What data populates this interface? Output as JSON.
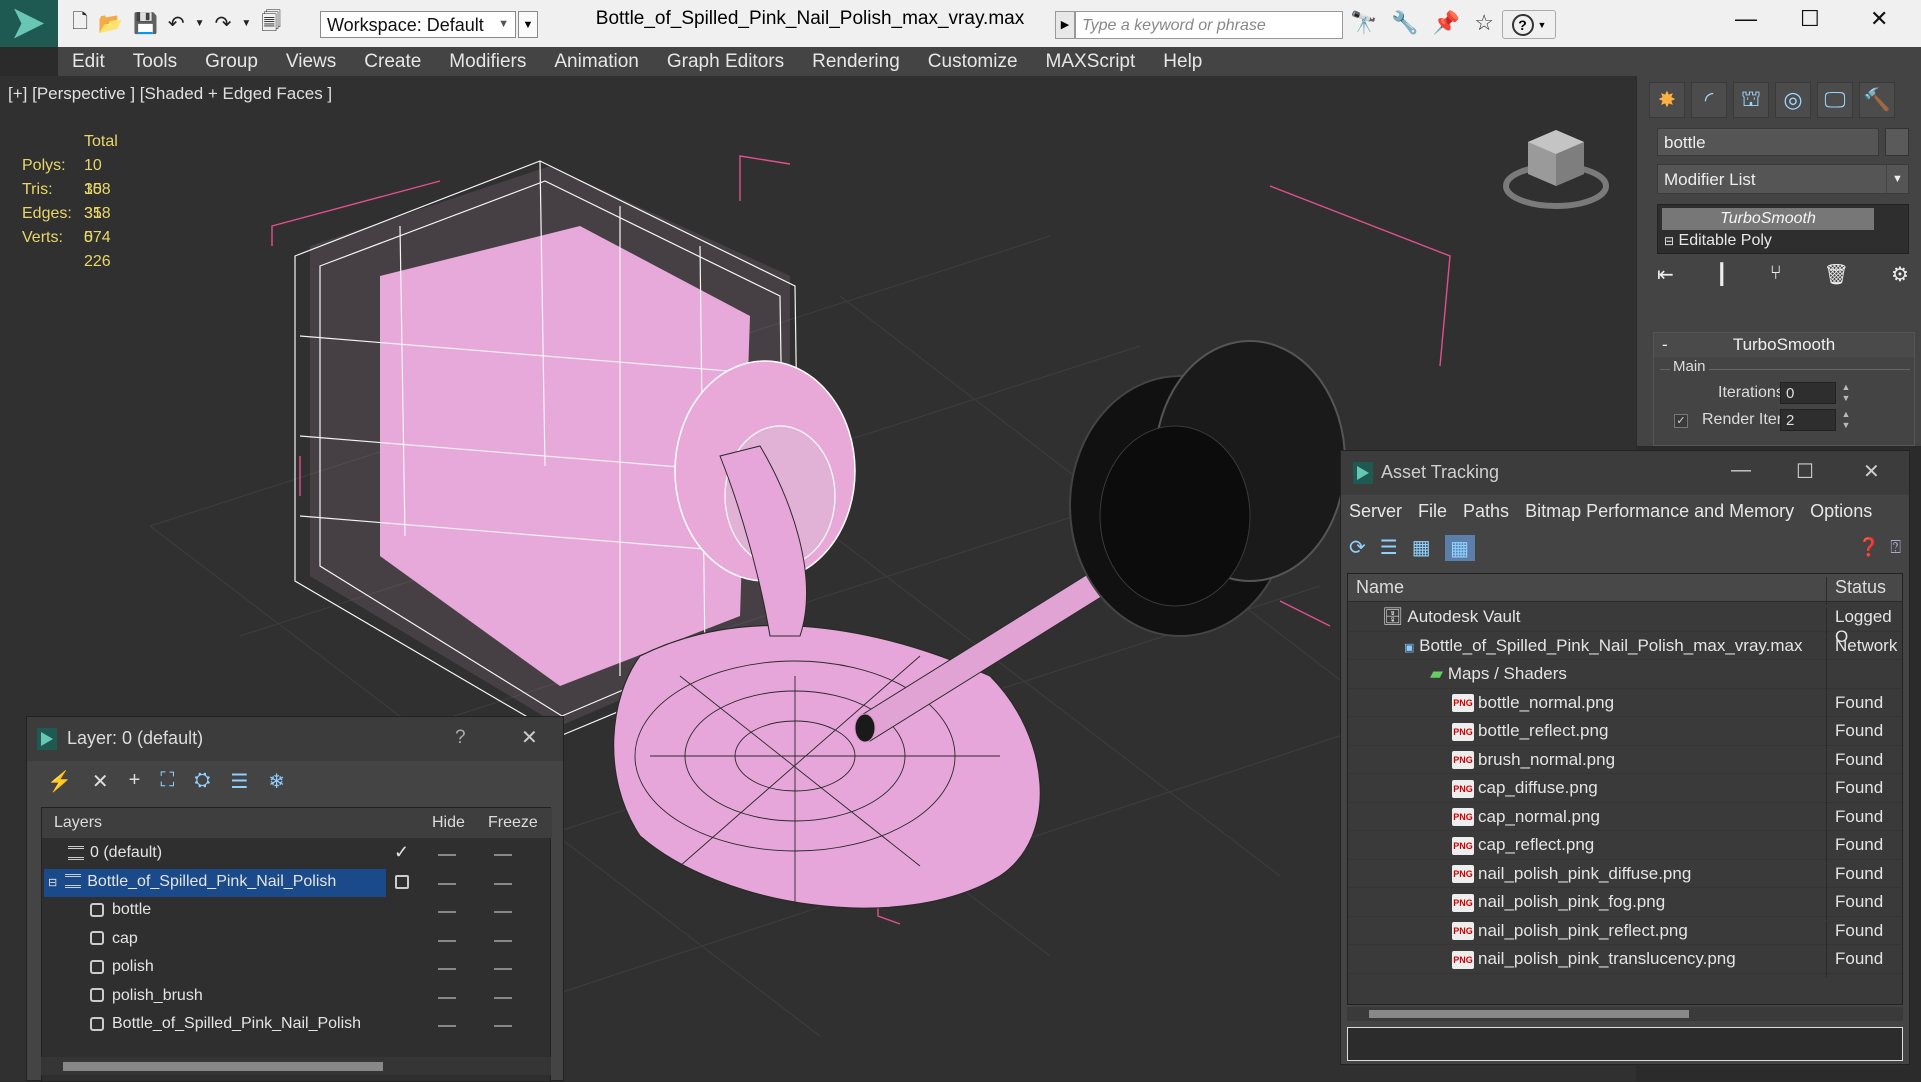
{
  "window": {
    "title": "Bottle_of_Spilled_Pink_Nail_Polish_max_vray.max",
    "workspace": "Workspace: Default",
    "search_placeholder": "Type a keyword or phrase"
  },
  "menu": [
    "Edit",
    "Tools",
    "Group",
    "Views",
    "Create",
    "Modifiers",
    "Animation",
    "Graph Editors",
    "Rendering",
    "Customize",
    "MAXScript",
    "Help"
  ],
  "viewport": {
    "label": "[+] [Perspective ] [Shaded + Edged Faces ]",
    "stats": {
      "header": "Total",
      "rows": [
        {
          "label": "Polys:",
          "value": "10 358"
        },
        {
          "label": "Tris:",
          "value": "10 358"
        },
        {
          "label": "Edges:",
          "value": "31 074"
        },
        {
          "label": "Verts:",
          "value": "5 226"
        }
      ]
    }
  },
  "command_panel": {
    "object_name": "bottle",
    "modifier_list": "Modifier List",
    "stack": [
      "TurboSmooth",
      "Editable Poly"
    ],
    "rollout_title": "TurboSmooth",
    "group_title": "Main",
    "iterations_label": "Iterations:",
    "iterations_value": "0",
    "render_iters_label": "Render Iters:",
    "render_iters_value": "2",
    "render_iters_checked": true
  },
  "asset_tracking": {
    "title": "Asset Tracking",
    "menu": [
      "Server",
      "File",
      "Paths",
      "Bitmap Performance and Memory",
      "Options"
    ],
    "columns": {
      "name": "Name",
      "status": "Status"
    },
    "rows": [
      {
        "name": "Autodesk Vault",
        "status": "Logged O",
        "type": "vault"
      },
      {
        "name": "Bottle_of_Spilled_Pink_Nail_Polish_max_vray.max",
        "status": "Network",
        "type": "max"
      },
      {
        "name": "Maps / Shaders",
        "status": "",
        "type": "folder"
      },
      {
        "name": "bottle_normal.png",
        "status": "Found",
        "type": "png"
      },
      {
        "name": "bottle_reflect.png",
        "status": "Found",
        "type": "png"
      },
      {
        "name": "brush_normal.png",
        "status": "Found",
        "type": "png"
      },
      {
        "name": "cap_diffuse.png",
        "status": "Found",
        "type": "png"
      },
      {
        "name": "cap_normal.png",
        "status": "Found",
        "type": "png"
      },
      {
        "name": "cap_reflect.png",
        "status": "Found",
        "type": "png"
      },
      {
        "name": "nail_polish_pink_diffuse.png",
        "status": "Found",
        "type": "png"
      },
      {
        "name": "nail_polish_pink_fog.png",
        "status": "Found",
        "type": "png"
      },
      {
        "name": "nail_polish_pink_reflect.png",
        "status": "Found",
        "type": "png"
      },
      {
        "name": "nail_polish_pink_translucency.png",
        "status": "Found",
        "type": "png"
      }
    ]
  },
  "layer_manager": {
    "title": "Layer: 0 (default)",
    "help": "?",
    "columns": {
      "layers": "Layers",
      "hide": "Hide",
      "freeze": "Freeze"
    },
    "rows": [
      {
        "name": "0 (default)",
        "kind": "layer",
        "selected": false
      },
      {
        "name": "Bottle_of_Spilled_Pink_Nail_Polish",
        "kind": "layer",
        "selected": true
      },
      {
        "name": "bottle",
        "kind": "object",
        "selected": false
      },
      {
        "name": "cap",
        "kind": "object",
        "selected": false
      },
      {
        "name": "polish",
        "kind": "object",
        "selected": false
      },
      {
        "name": "polish_brush",
        "kind": "object",
        "selected": false
      },
      {
        "name": "Bottle_of_Spilled_Pink_Nail_Polish",
        "kind": "object",
        "selected": false
      }
    ]
  },
  "colors": {
    "pink": "#e8a8d8",
    "accent": "#1a4a8a",
    "stat_text": "#e8d66a"
  }
}
